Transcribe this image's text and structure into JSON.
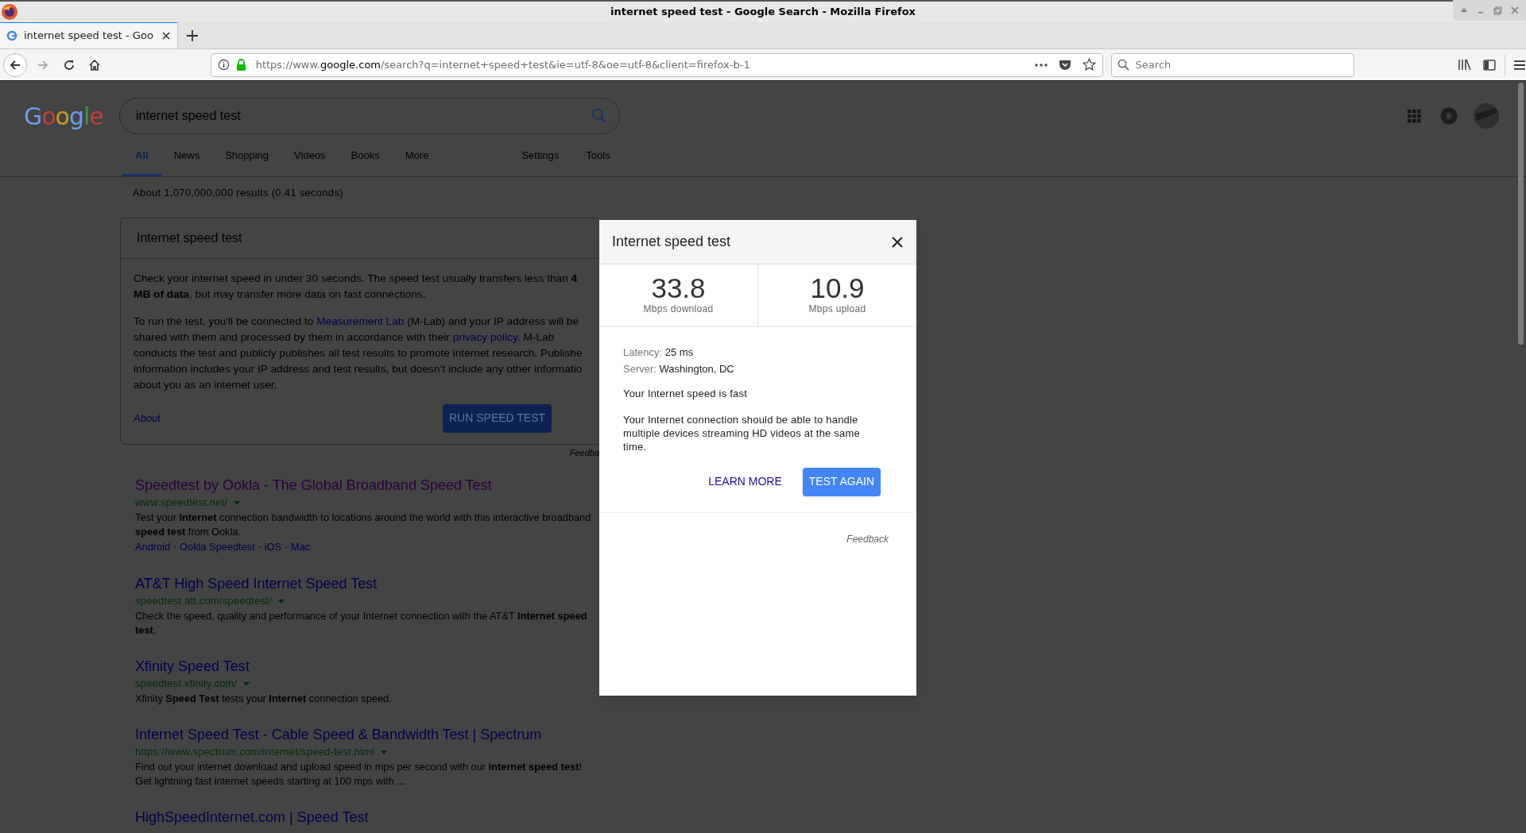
{
  "window": {
    "title": "internet speed test - Google Search - Mozilla Firefox"
  },
  "tabs": [
    {
      "title": "internet speed test - Goo",
      "selected": true
    }
  ],
  "address_bar": {
    "segments": [
      {
        "text": "https://www.",
        "kind": "dim"
      },
      {
        "text": "google.com",
        "kind": "host"
      },
      {
        "text": "/search?q=internet+speed+test&ie=utf-8&oe=utf-8&client=firefox-b-1",
        "kind": "dim"
      }
    ]
  },
  "search_bar": {
    "placeholder": "Search"
  },
  "google": {
    "logo": "Google",
    "query": "internet speed test",
    "nav_tabs": [
      {
        "label": "All",
        "selected": true
      },
      {
        "label": "News",
        "selected": false
      },
      {
        "label": "Shopping",
        "selected": false
      },
      {
        "label": "Videos",
        "selected": false
      },
      {
        "label": "Books",
        "selected": false
      },
      {
        "label": "More",
        "selected": false
      }
    ],
    "tool_tabs": [
      "Settings",
      "Tools"
    ],
    "result_stats": "About 1,070,000,000 results (0.41 seconds)"
  },
  "card": {
    "title": "Internet speed test",
    "paragraphs": [
      [
        [
          {
            "text": "Check your internet speed in under 30 seconds. The speed test usually transfers less than **4**",
            "kind": "text"
          }
        ],
        [
          {
            "text": "**MB of data**, but may transfer more data on fast connections.",
            "kind": "text"
          }
        ]
      ],
      [
        [
          {
            "text": "To run the test, you'll be connected to ",
            "kind": "text"
          },
          {
            "text": "Measurement Lab",
            "kind": "link"
          },
          {
            "text": " (M-Lab) and your IP address will be",
            "kind": "text"
          }
        ],
        [
          {
            "text": "shared with them and processed by them in accordance with their ",
            "kind": "text"
          },
          {
            "text": "privacy policy",
            "kind": "link"
          },
          {
            "text": ". M-Lab",
            "kind": "text"
          }
        ],
        [
          {
            "text": "conducts the test and publicly publishes all test results to promote internet research. Publishe",
            "kind": "text"
          }
        ],
        [
          {
            "text": "information includes your IP address and test results, but doesn’t include any other informatio",
            "kind": "text"
          }
        ],
        [
          {
            "text": "about you as an internet user.",
            "kind": "text"
          }
        ]
      ]
    ],
    "about": "About",
    "run_button": "RUN SPEED TEST",
    "feedback": "Feedba"
  },
  "results": [
    {
      "title": "Speedtest by Ookla - The Global Broadband Speed Test",
      "visited": true,
      "url": "www.speedtest.net/",
      "snippet": [
        "Test your **Internet** connection bandwidth to locations around the world with this interactive broadband",
        "**speed test** from Ookla."
      ],
      "sitelinks": [
        "Android",
        "Ookla Speedtest",
        "iOS",
        "Mac"
      ]
    },
    {
      "title": "AT&T High Speed Internet Speed Test",
      "visited": false,
      "url": "speedtest.att.com/speedtest/",
      "snippet": [
        "Check the speed, quality and performance of your Internet connection with the AT&T **Internet speed**",
        "**test**."
      ]
    },
    {
      "title": "Xfinity Speed Test",
      "visited": false,
      "url": "speedtest.xfinity.com/",
      "snippet": [
        "Xfinity **Speed Test** tests your **Internet** connection speed."
      ]
    },
    {
      "title": "Internet Speed Test - Cable Speed & Bandwidth Test | Spectrum",
      "visited": false,
      "url": "https://www.spectrum.com/internet/speed-test.html",
      "snippet": [
        "Find out your internet download and upload speed in mps per second with our **internet speed test**!",
        "Get lightning fast internet speeds starting at 100 mps with ..."
      ]
    },
    {
      "title": "HighSpeedInternet.com | Speed Test",
      "visited": false
    }
  ],
  "dialog": {
    "title": "Internet speed test",
    "stats": [
      {
        "value": "33.8",
        "label": "Mbps download"
      },
      {
        "value": "10.9",
        "label": "Mbps upload"
      }
    ],
    "details": [
      {
        "label": "Latency:",
        "value": "25 ms"
      },
      {
        "label": "Server:",
        "value": "Washington, DC"
      }
    ],
    "verdict": "Your Internet speed is fast",
    "description": "Your Internet connection should be able to handle multiple devices streaming HD videos at the same time.",
    "learn_more": "LEARN MORE",
    "test_again": "TEST AGAIN",
    "feedback": "Feedback"
  }
}
